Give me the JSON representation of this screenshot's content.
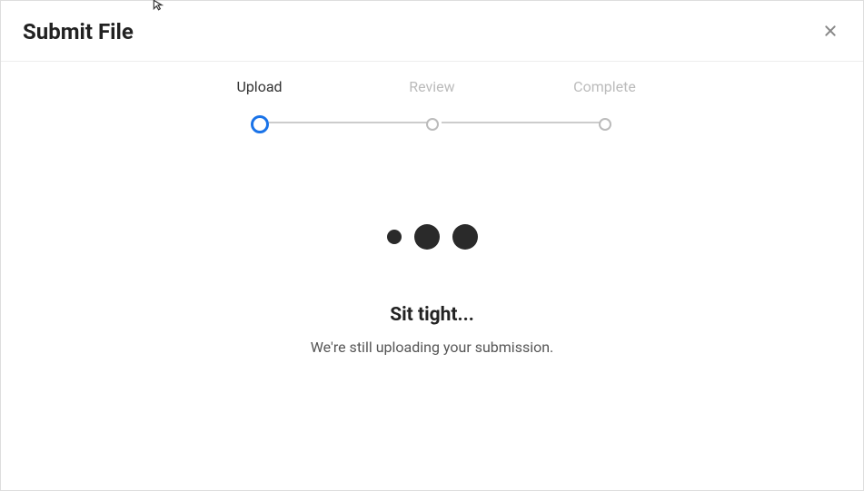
{
  "modal": {
    "title": "Submit File"
  },
  "stepper": {
    "steps": [
      {
        "label": "Upload",
        "state": "active"
      },
      {
        "label": "Review",
        "state": "inactive"
      },
      {
        "label": "Complete",
        "state": "inactive"
      }
    ]
  },
  "status": {
    "title": "Sit tight...",
    "message": "We're still uploading your submission."
  }
}
